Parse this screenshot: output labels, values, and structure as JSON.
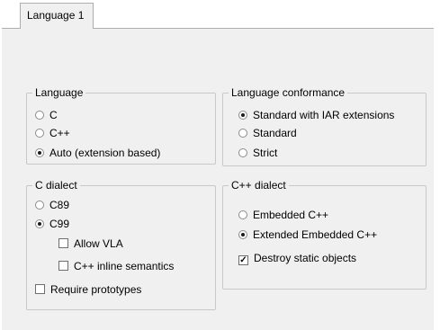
{
  "tabs": [
    {
      "label": "Language 1"
    }
  ],
  "language": {
    "title": "Language",
    "options": [
      {
        "label": "C",
        "selected": false
      },
      {
        "label": "C++",
        "selected": false
      },
      {
        "label": "Auto (extension based)",
        "selected": true
      }
    ]
  },
  "conformance": {
    "title": "Language conformance",
    "options": [
      {
        "label": "Standard with IAR extensions",
        "selected": true
      },
      {
        "label": "Standard",
        "selected": false
      },
      {
        "label": "Strict",
        "selected": false
      }
    ]
  },
  "c_dialect": {
    "title": "C dialect",
    "options": [
      {
        "label": "C89",
        "selected": false
      },
      {
        "label": "C99",
        "selected": true
      }
    ],
    "allow_vla": {
      "label": "Allow VLA",
      "checked": false
    },
    "cpp_inline": {
      "label": "C++ inline semantics",
      "checked": false
    },
    "require_prototypes": {
      "label": "Require prototypes",
      "checked": false
    }
  },
  "cpp_dialect": {
    "title": "C++ dialect",
    "options": [
      {
        "label": "Embedded C++",
        "selected": false
      },
      {
        "label": "Extended Embedded C++",
        "selected": true
      }
    ],
    "destroy_static": {
      "label": "Destroy static objects",
      "checked": true
    }
  },
  "check_glyph": "✓"
}
